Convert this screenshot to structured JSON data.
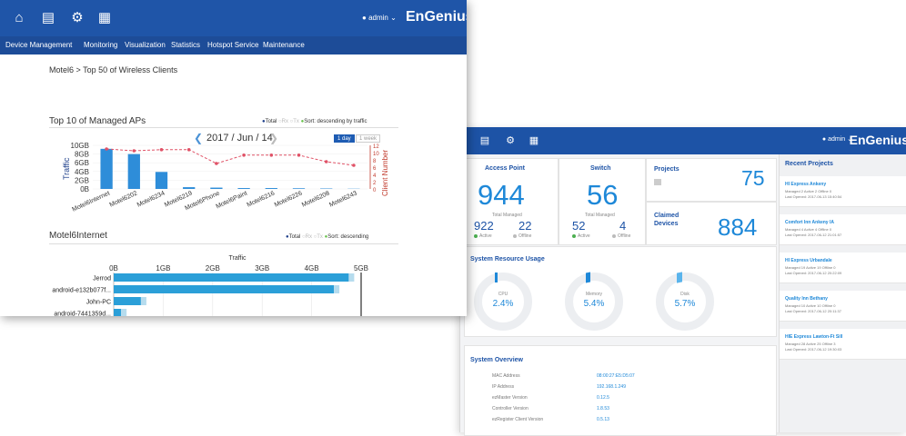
{
  "front": {
    "toolbar_icons": [
      "home-icon",
      "calendar-icon",
      "gear-icon",
      "clipboard-icon"
    ],
    "user": "admin",
    "logo": "EnGenius",
    "menu": [
      "Device Management",
      "Monitoring",
      "Visualization",
      "Statistics",
      "Hotspot Service",
      "Maintenance"
    ],
    "breadcrumb": "Motel6 > Top 50 of Wireless Clients",
    "top_aps": {
      "title": "Top 10 of Managed APs",
      "legend": {
        "total": "Total",
        "rx": "Rx",
        "tx": "Tx",
        "sort": "Sort: descending by traffic"
      },
      "date": "2017 / Jun / 14",
      "range_buttons": [
        "1 day",
        "1 week"
      ],
      "ylabel_left": "Traffic",
      "ylabel_right": "Client Number"
    },
    "client_chart": {
      "title": "Motel6Internet",
      "legend": {
        "total": "Total",
        "rx": "Rx",
        "tx": "Tx",
        "sort": "Sort: descending"
      },
      "axis_title": "Traffic"
    }
  },
  "back": {
    "user": "admin",
    "logo": "EnGenius",
    "access_point": {
      "title": "Access Point",
      "total": "944",
      "total_label": "Total Managed",
      "active": "922",
      "active_label": "Active",
      "offline": "22",
      "offline_label": "Offline"
    },
    "switch": {
      "title": "Switch",
      "total": "56",
      "total_label": "Total Managed",
      "active": "52",
      "active_label": "Active",
      "offline": "4",
      "offline_label": "Offline"
    },
    "projects": {
      "title": "Projects",
      "value": "75"
    },
    "claimed": {
      "title": "Claimed Devices",
      "value": "884"
    },
    "resource": {
      "title": "System Resource Usage",
      "cpu": {
        "label": "CPU",
        "value": "2.4%",
        "pct": 0.024
      },
      "memory": {
        "label": "Memory",
        "value": "5.4%",
        "pct": 0.054
      },
      "disk": {
        "label": "Disk",
        "value": "5.7%",
        "pct": 0.057
      }
    },
    "overview": {
      "title": "System Overview",
      "rows": [
        {
          "k": "MAC Address",
          "v": "08:00:27:E5:D5:07"
        },
        {
          "k": "IP Address",
          "v": "192.168.1.249"
        },
        {
          "k": "ezMaster Version",
          "v": "0.12.5"
        },
        {
          "k": "Controller Version",
          "v": "1.8.53"
        },
        {
          "k": "ezRegister Client Version",
          "v": "0.5.13"
        }
      ]
    },
    "recent": {
      "title": "Recent Projects",
      "items": [
        {
          "name": "HI Express Ankeny",
          "l1": "Managed 2  Active 2  Offline 0",
          "l2": "Last Opened: 2017-06-13 15:40:54"
        },
        {
          "name": "Comfort Inn Ankeny IA",
          "l1": "Managed 4  Active 4  Offline 0",
          "l2": "Last Opened: 2017-06-12 21:01:57"
        },
        {
          "name": "HI Express Urbandale",
          "l1": "Managed 19  Active 19  Offline 0",
          "l2": "Last Opened: 2017-06-12 20:22:09"
        },
        {
          "name": "Quality Inn Bethany",
          "l1": "Managed 10  Active 10  Offline 0",
          "l2": "Last Opened: 2017-06-12 20:11:37"
        },
        {
          "name": "HIE Express Lawton-Ft Sill",
          "l1": "Managed 28  Active 25  Offline 3",
          "l2": "Last Opened: 2017-06-12 19:30:03"
        }
      ]
    }
  },
  "chart_data": [
    {
      "type": "bar",
      "title": "Top 10 of Managed APs",
      "ylabel": "Traffic",
      "y2label": "Client Number",
      "yticks": [
        "10GB",
        "8GB",
        "6GB",
        "4GB",
        "2GB",
        "0B"
      ],
      "y2ticks": [
        "12",
        "10",
        "8",
        "6",
        "4",
        "2",
        "0"
      ],
      "ylim": [
        0,
        10
      ],
      "y2lim": [
        0,
        12
      ],
      "categories": [
        "Motel6Internet",
        "Motel6202",
        "Motel6234",
        "Motel6219",
        "Motel6Phone",
        "Motel6Paint",
        "Motel6216",
        "Motel6226",
        "Motel6208",
        "Motel6243"
      ],
      "series": [
        {
          "name": "Total",
          "values": [
            9.2,
            8.0,
            3.9,
            0.4,
            0.3,
            0.2,
            0.2,
            0.15,
            0.1,
            0.05
          ]
        }
      ],
      "line": [
        11,
        10.5,
        10.8,
        10.8,
        7.0,
        9.3,
        9.3,
        9.3,
        7.5,
        6.5
      ],
      "colors": {
        "bar": "#2e8dd9",
        "line": "#e05267"
      }
    },
    {
      "type": "bar",
      "orientation": "horizontal",
      "title": "Motel6Internet",
      "xlabel": "Traffic",
      "xticks": [
        "0B",
        "1GB",
        "2GB",
        "3GB",
        "4GB",
        "5GB"
      ],
      "xlim": [
        0,
        5
      ],
      "categories": [
        "Jerrod",
        "android-e132b077f...",
        "John-PC",
        "android-7441359d..."
      ],
      "series": [
        {
          "name": "Total",
          "values": [
            4.75,
            4.45,
            0.55,
            0.15
          ]
        }
      ],
      "colors": {
        "bar": "#2b9fd8",
        "rx": "#b6dcee"
      }
    }
  ]
}
